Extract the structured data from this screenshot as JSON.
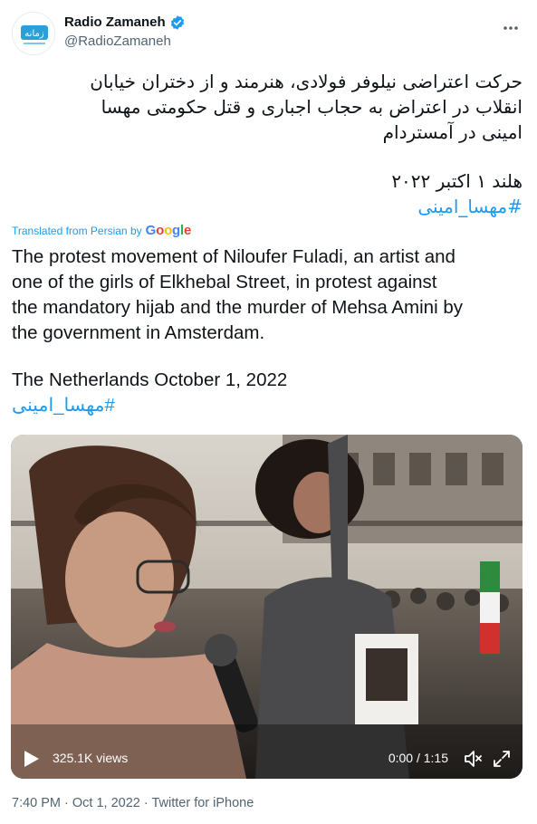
{
  "tweet": {
    "display_name": "Radio Zamaneh",
    "handle": "@RadioZamaneh",
    "avatar_text": "زمانه",
    "persian_lines": [
      "حرکت اعتراضی نیلوفر فولادی، هنرمند و از دختران خیابان",
      "انقلاب در اعتراض به حجاب اجباری و قتل حکومتی مهسا",
      "امینی در آمستردام"
    ],
    "persian_date": "هلند ۱ اکتبر ۲۰۲۲",
    "persian_hashtag": "#مهسا_امینی",
    "translated_label": "Translated from Persian by",
    "google_letters": [
      "G",
      "o",
      "o",
      "g",
      "l",
      "e"
    ],
    "english_lines": [
      "The protest movement of Niloufer Fuladi, an artist and",
      "one of the girls of Elkhebal Street, in protest against",
      "the mandatory hijab and the murder of Mehsa Amini by",
      "the government in Amsterdam."
    ],
    "english_date": "The Netherlands October 1, 2022",
    "english_hashtag": "#مهسا_امینی",
    "video": {
      "views": "325.1K views",
      "time": "0:00 / 1:15"
    },
    "footer": "7:40 PM · Oct 1, 2022 · Twitter for iPhone"
  },
  "colors": {
    "link": "#1d9bf0",
    "verified": "#1d9bf0",
    "secondary_text": "#536471",
    "primary_text": "#0f1419"
  },
  "icons": [
    "verified-badge-icon",
    "more-options-icon",
    "play-icon",
    "volume-icon",
    "fullscreen-icon"
  ]
}
